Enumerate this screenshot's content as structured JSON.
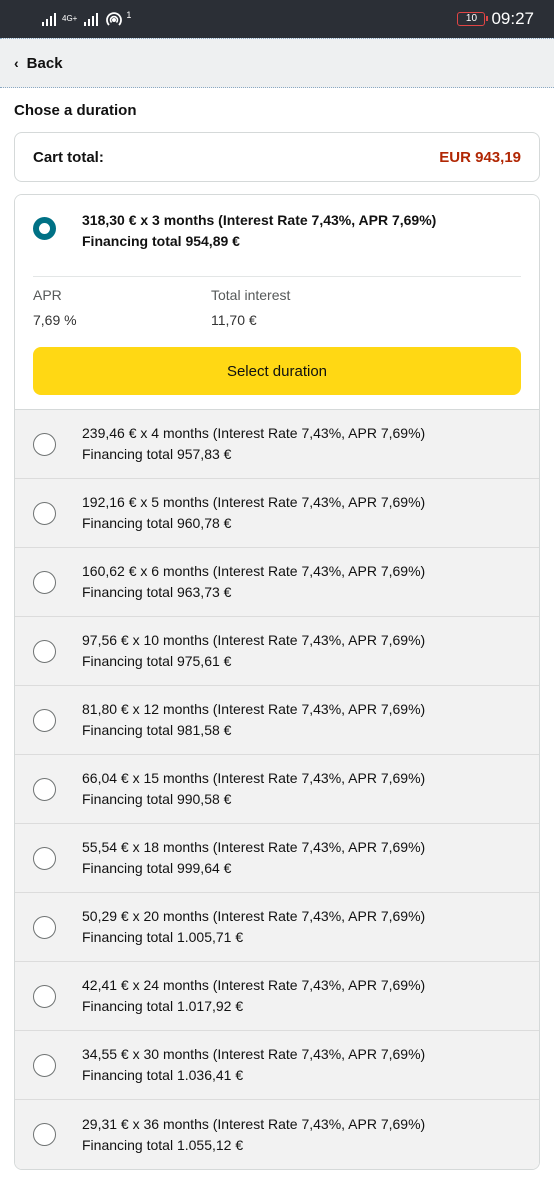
{
  "status_bar": {
    "network": "4G+",
    "hotspot_badge": "1",
    "battery": "10",
    "time": "09:27"
  },
  "nav": {
    "back_label": "Back"
  },
  "heading": "Chose a duration",
  "cart": {
    "label": "Cart total:",
    "amount": "EUR 943,19"
  },
  "selected_option": {
    "line1": "318,30 € x 3 months (Interest Rate 7,43%, APR 7,69%)",
    "line2": "Financing total 954,89 €",
    "apr_label": "APR",
    "apr_value": "7,69 %",
    "interest_label": "Total interest",
    "interest_value": "11,70 €",
    "button_label": "Select duration"
  },
  "options": [
    {
      "line1": "239,46 € x 4 months (Interest Rate 7,43%, APR 7,69%)",
      "line2": "Financing total 957,83 €"
    },
    {
      "line1": "192,16 € x 5 months (Interest Rate 7,43%, APR 7,69%)",
      "line2": "Financing total 960,78 €"
    },
    {
      "line1": "160,62 € x 6 months (Interest Rate 7,43%, APR 7,69%)",
      "line2": "Financing total 963,73 €"
    },
    {
      "line1": "97,56 € x 10 months (Interest Rate 7,43%, APR 7,69%)",
      "line2": "Financing total 975,61 €"
    },
    {
      "line1": "81,80 € x 12 months (Interest Rate 7,43%, APR 7,69%)",
      "line2": "Financing total 981,58 €"
    },
    {
      "line1": "66,04 € x 15 months (Interest Rate 7,43%, APR 7,69%)",
      "line2": "Financing total 990,58 €"
    },
    {
      "line1": "55,54 € x 18 months (Interest Rate 7,43%, APR 7,69%)",
      "line2": "Financing total 999,64 €"
    },
    {
      "line1": "50,29 € x 20 months (Interest Rate 7,43%, APR 7,69%)",
      "line2": "Financing total 1.005,71 €"
    },
    {
      "line1": "42,41 € x 24 months (Interest Rate 7,43%, APR 7,69%)",
      "line2": "Financing total 1.017,92 €"
    },
    {
      "line1": "34,55 € x 30 months (Interest Rate 7,43%, APR 7,69%)",
      "line2": "Financing total 1.036,41 €"
    },
    {
      "line1": "29,31 € x 36 months (Interest Rate 7,43%, APR 7,69%)",
      "line2": "Financing total 1.055,12 €"
    }
  ],
  "colors": {
    "accent_radio": "#007185",
    "price": "#b12704",
    "button": "#ffd814"
  }
}
